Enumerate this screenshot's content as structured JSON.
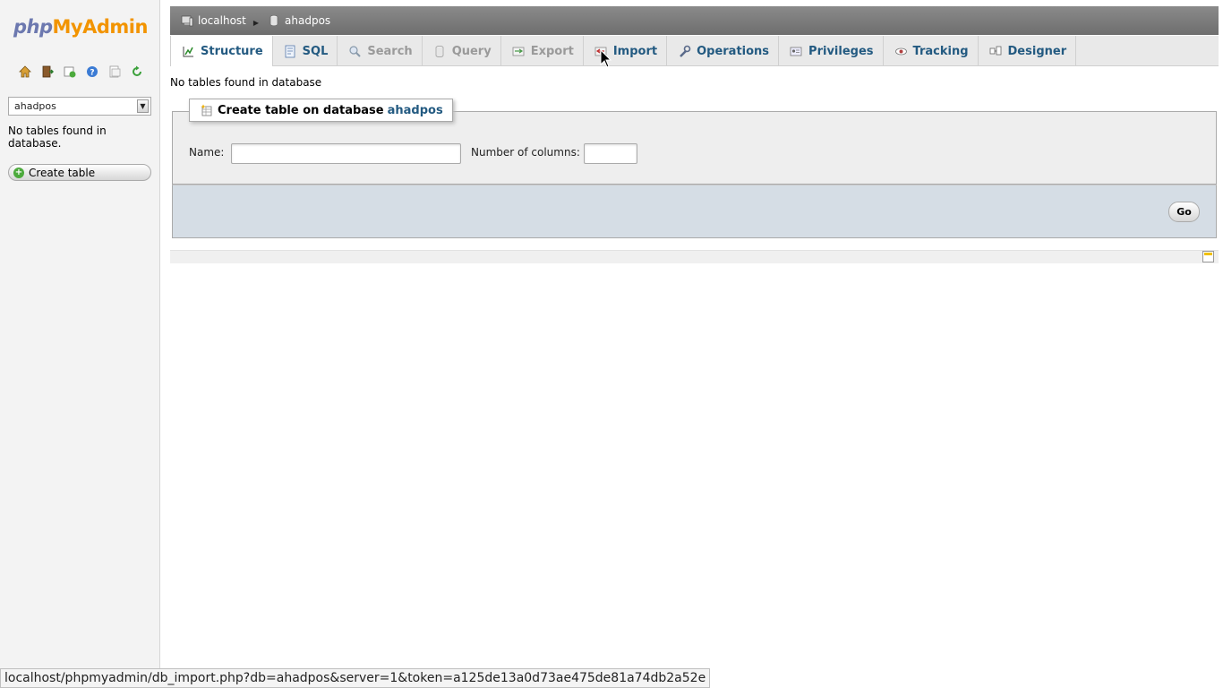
{
  "logo": {
    "php": "php",
    "my": "My",
    "admin": "Admin"
  },
  "nav_icons": [
    "home-icon",
    "exit-icon",
    "query-window-icon",
    "docs-icon",
    "settings-icon",
    "reload-icon"
  ],
  "sidebar": {
    "selected_db": "ahadpos",
    "empty_message": "No tables found in database.",
    "create_table_label": "Create table"
  },
  "breadcrumb": {
    "server": "localhost",
    "database": "ahadpos"
  },
  "tabs": [
    {
      "label": "Structure",
      "icon": "structure-icon",
      "state": "active"
    },
    {
      "label": "SQL",
      "icon": "sql-icon",
      "state": "normal"
    },
    {
      "label": "Search",
      "icon": "search-icon",
      "state": "disabled"
    },
    {
      "label": "Query",
      "icon": "query-icon",
      "state": "disabled"
    },
    {
      "label": "Export",
      "icon": "export-icon",
      "state": "disabled"
    },
    {
      "label": "Import",
      "icon": "import-icon",
      "state": "normal"
    },
    {
      "label": "Operations",
      "icon": "wrench-icon",
      "state": "normal"
    },
    {
      "label": "Privileges",
      "icon": "privileges-icon",
      "state": "normal"
    },
    {
      "label": "Tracking",
      "icon": "eye-icon",
      "state": "normal"
    },
    {
      "label": "Designer",
      "icon": "designer-icon",
      "state": "normal"
    }
  ],
  "main": {
    "no_tables": "No tables found in database",
    "create_legend": "Create table on database",
    "create_legend_db": "ahadpos",
    "name_label": "Name:",
    "name_value": "",
    "columns_label": "Number of columns:",
    "columns_value": "",
    "go_label": "Go"
  },
  "status_bar": {
    "url": "localhost/phpmyadmin/db_import.php?db=ahadpos&server=1&token=a125de13a0d73ae475de81a74db2a52e"
  },
  "colors": {
    "link": "#235a81",
    "logo_php": "#6c78af",
    "logo_myadmin": "#f29400",
    "topbar": "#7b7b7b",
    "footer": "#d5dde5"
  }
}
